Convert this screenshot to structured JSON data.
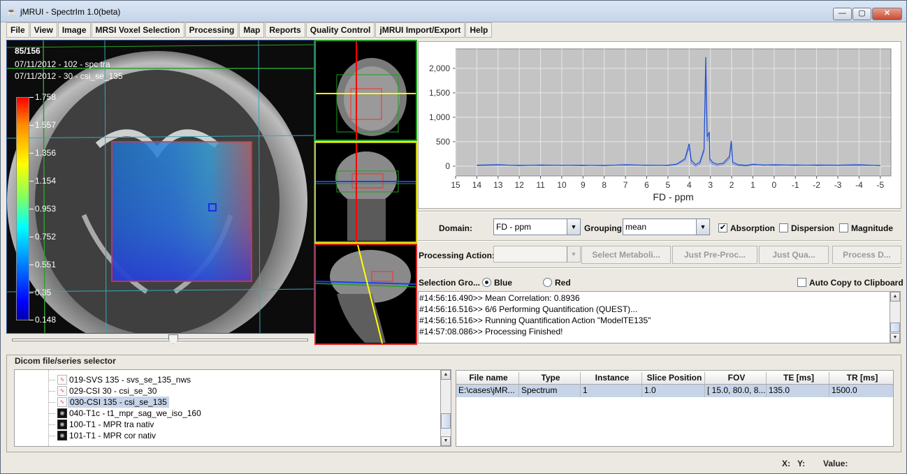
{
  "window": {
    "title": "jMRUI - SpectrIm 1.0(beta)",
    "min_glyph": "—",
    "max_glyph": "▢",
    "close_glyph": "✕"
  },
  "menu": [
    "File",
    "View",
    "Image",
    "MRSI Voxel Selection",
    "Processing",
    "Map",
    "Reports",
    "Quality Control",
    "jMRUI Import/Export",
    "Help"
  ],
  "main_image": {
    "counter": "85/156",
    "series1": "07/11/2012 - 102 - spc tra",
    "series2": "07/11/2012 - 30 - csi_se_135",
    "colorbar_labels": [
      "1.758",
      "1.557",
      "1.356",
      "1.154",
      "0.953",
      "0.752",
      "0.551",
      "0.35",
      "0.148"
    ],
    "slice_slider": 0.53
  },
  "chart_data": {
    "type": "line",
    "title": "",
    "xlabel": "FD - ppm",
    "ylabel": "",
    "xlim": [
      15,
      -5.5
    ],
    "ylim": [
      -200,
      2400
    ],
    "x_ticks": [
      "15",
      "14",
      "13",
      "12",
      "11",
      "10",
      "9",
      "8",
      "7",
      "6",
      "5",
      "4",
      "3",
      "2",
      "1",
      "0",
      "-1",
      "-2",
      "-3",
      "-4",
      "-5"
    ],
    "y_ticks": [
      "0",
      "500",
      "1,000",
      "1,500",
      "2,000"
    ],
    "grid": true,
    "series": [
      {
        "color": "#1f4fd0",
        "x": [
          14,
          13,
          12,
          11,
          10,
          9,
          8,
          7,
          6,
          5,
          4.6,
          4.2,
          4.0,
          3.9,
          3.7,
          3.5,
          3.3,
          3.22,
          3.15,
          3.05,
          3.03,
          2.9,
          2.7,
          2.4,
          2.1,
          2.02,
          1.95,
          1.7,
          1.3,
          1.0,
          0.5,
          0,
          -1,
          -2,
          -3,
          -4,
          -5
        ],
        "y": [
          20,
          30,
          10,
          25,
          15,
          20,
          10,
          30,
          15,
          20,
          40,
          150,
          460,
          120,
          30,
          80,
          350,
          2230,
          600,
          700,
          150,
          80,
          40,
          60,
          200,
          520,
          80,
          30,
          15,
          40,
          20,
          30,
          15,
          25,
          20,
          30,
          10
        ]
      },
      {
        "color": "#6f8fe8",
        "x": [
          14,
          13,
          12,
          11,
          10,
          9,
          8,
          7,
          6,
          5,
          4.6,
          4.2,
          4.0,
          3.9,
          3.7,
          3.5,
          3.3,
          3.22,
          3.15,
          3.05,
          3.03,
          2.9,
          2.7,
          2.4,
          2.1,
          2.02,
          1.95,
          1.7,
          1.3,
          1.0,
          0.5,
          0,
          -1,
          -2,
          -3,
          -4,
          -5
        ],
        "y": [
          10,
          15,
          25,
          10,
          20,
          10,
          25,
          15,
          25,
          10,
          30,
          120,
          380,
          60,
          0,
          40,
          300,
          1900,
          500,
          650,
          90,
          40,
          10,
          30,
          150,
          480,
          40,
          10,
          5,
          20,
          30,
          10,
          30,
          10,
          15,
          10,
          20
        ]
      }
    ]
  },
  "controls": {
    "domain_label": "Domain:",
    "domain_value": "FD - ppm",
    "grouping_label": "Grouping:",
    "grouping_value": "mean",
    "absorption_label": "Absorption",
    "absorption_checked": true,
    "dispersion_label": "Dispersion",
    "magnitude_label": "Magnitude",
    "processing_action_label": "Processing Action:",
    "processing_action_value": "",
    "select_metabolites_btn": "Select Metaboli...",
    "just_preproc_btn": "Just Pre-Proc...",
    "just_quant_btn": "Just Qua...",
    "process_btn": "Process D...",
    "selection_group_label": "Selection Gro...",
    "radio_blue": "Blue",
    "radio_red": "Red",
    "selected_group": "Blue",
    "auto_copy_label": "Auto Copy to Clipboard"
  },
  "log_lines": [
    "#14:56:16.490>> Mean Correlation: 0.8936",
    "#14:56:16.516>> 6/6 Performing Quantification (QUEST)...",
    "#14:56:16.516>> Running Quantification Action \"ModelTE135\"",
    "#14:57:08.086>> Processing Finished!"
  ],
  "selector": {
    "title": "Dicom file/series selector",
    "items": [
      "019-SVS 135 - svs_se_135_nws",
      "029-CSI 30 - csi_se_30",
      "030-CSI 135 - csi_se_135",
      "040-T1c - t1_mpr_sag_we_iso_160",
      "100-T1 - MPR tra nativ",
      "101-T1 - MPR cor nativ"
    ],
    "selected_item": "030-CSI 135 - csi_se_135"
  },
  "table": {
    "headers": [
      "File name",
      "Type",
      "Instance",
      "Slice Position",
      "FOV",
      "TE [ms]",
      "TR [ms]"
    ],
    "rows": [
      [
        "E:\\cases\\jMR...",
        "Spectrum",
        "1",
        "1.0",
        "[ 15.0, 80.0, 8...",
        "135.0",
        "1500.0"
      ]
    ]
  },
  "status": {
    "x_label": "X:",
    "y_label": "Y:",
    "value_label": "Value:"
  }
}
